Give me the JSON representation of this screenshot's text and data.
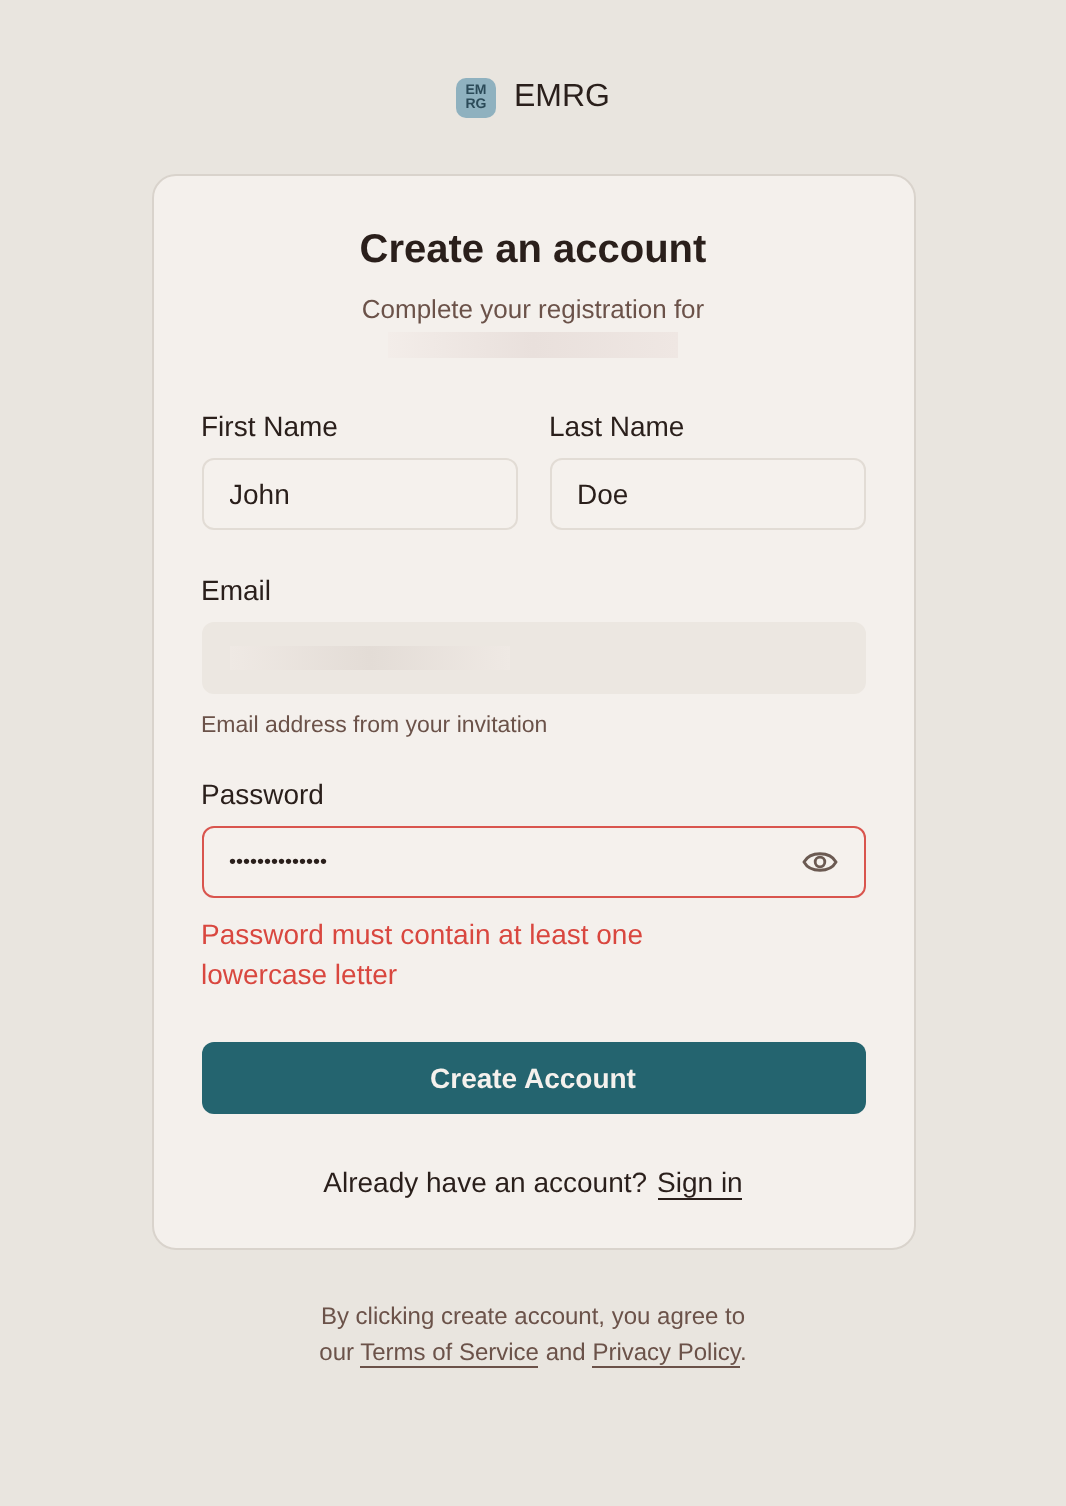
{
  "brand": {
    "mark_lines": [
      "EM",
      "RG"
    ],
    "name": "EMRG"
  },
  "card": {
    "title": "Create an account",
    "subtitle": "Complete your registration for",
    "subtitle_redacted": true
  },
  "name_fields": [
    {
      "label": "First Name",
      "value": "John"
    },
    {
      "label": "Last Name",
      "value": "Doe"
    }
  ],
  "email": {
    "label": "Email",
    "disabled": true,
    "redacted": true,
    "hint": "Email address from your invitation"
  },
  "password": {
    "label": "Password",
    "value": "••••••••••••••",
    "invalid": true,
    "error": "Password must contain at least one lowercase letter"
  },
  "submit": "Create Account",
  "signin": {
    "prompt": "Already have an account?",
    "link": "Sign in"
  },
  "footer": [
    {
      "kind": "text",
      "text": "By clicking create account, you agree to our"
    },
    {
      "kind": "link",
      "text": "Terms of Service"
    },
    {
      "kind": "text",
      "text": "and"
    },
    {
      "kind": "link",
      "text": "Privacy Policy"
    },
    {
      "kind": "text",
      "text": "."
    }
  ]
}
